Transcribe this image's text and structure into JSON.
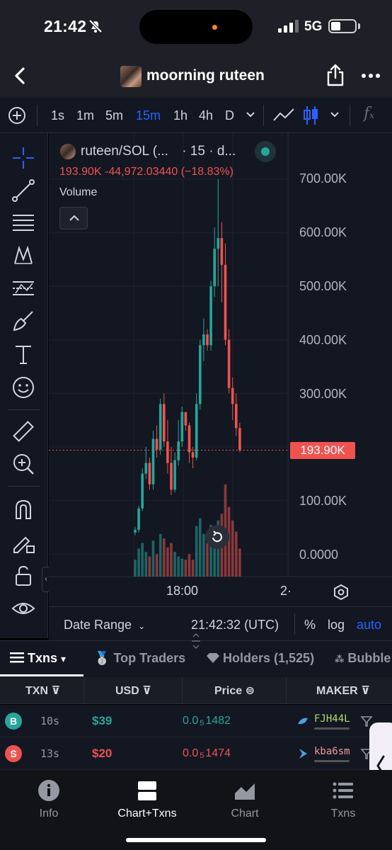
{
  "status_bar": {
    "time": "21:42",
    "network": "5G"
  },
  "header": {
    "title": "moorning ruteen"
  },
  "toolbar": {
    "intervals": [
      "1s",
      "1m",
      "5m",
      "15m",
      "1h",
      "4h",
      "D"
    ],
    "active_interval": "15m",
    "colors": {
      "active": "#2962ff"
    }
  },
  "legend": {
    "symbol": "ruteen/SOL (...",
    "interval": "· 15 · d...",
    "ohlc": "193.90K  -44,972.03440 (−18.83%)",
    "volume_label": "Volume"
  },
  "chart_data": {
    "type": "candlestick",
    "price_axis_labels": [
      "700.00K",
      "600.00K",
      "500.00K",
      "400.00K",
      "300.00K",
      "100.00K",
      "0.0000"
    ],
    "time_axis_labels": [
      "18:00",
      "2·"
    ],
    "last_price_label": "193.90K",
    "ylim": [
      0,
      720000
    ],
    "up_color": "#26a69a",
    "down_color": "#ef5350",
    "candles": [
      [
        40000,
        50000,
        35000,
        45000,
        150
      ],
      [
        45000,
        90000,
        40000,
        85000,
        250
      ],
      [
        85000,
        160000,
        80000,
        150000,
        300
      ],
      [
        150000,
        200000,
        140000,
        170000,
        220
      ],
      [
        170000,
        180000,
        120000,
        130000,
        180
      ],
      [
        130000,
        230000,
        120000,
        215000,
        320
      ],
      [
        215000,
        240000,
        180000,
        195000,
        200
      ],
      [
        195000,
        290000,
        185000,
        280000,
        380
      ],
      [
        280000,
        300000,
        200000,
        210000,
        340
      ],
      [
        210000,
        250000,
        150000,
        170000,
        260
      ],
      [
        170000,
        200000,
        110000,
        120000,
        300
      ],
      [
        120000,
        190000,
        115000,
        175000,
        220
      ],
      [
        175000,
        250000,
        165000,
        210000,
        180
      ],
      [
        210000,
        275000,
        200000,
        265000,
        160
      ],
      [
        265000,
        250000,
        230000,
        240000,
        150
      ],
      [
        240000,
        245000,
        170000,
        190000,
        200
      ],
      [
        190000,
        200000,
        160000,
        180000,
        150
      ],
      [
        180000,
        300000,
        175000,
        280000,
        450
      ],
      [
        280000,
        400000,
        270000,
        390000,
        520
      ],
      [
        390000,
        440000,
        360000,
        410000,
        380
      ],
      [
        410000,
        420000,
        380000,
        390000,
        300
      ],
      [
        390000,
        510000,
        380000,
        500000,
        460
      ],
      [
        500000,
        610000,
        480000,
        570000,
        420
      ],
      [
        570000,
        700000,
        500000,
        590000,
        500
      ],
      [
        590000,
        620000,
        470000,
        540000,
        560
      ],
      [
        540000,
        580000,
        390000,
        400000,
        820
      ],
      [
        400000,
        420000,
        300000,
        310000,
        620
      ],
      [
        310000,
        330000,
        250000,
        280000,
        500
      ],
      [
        280000,
        300000,
        220000,
        235000,
        400
      ],
      [
        235000,
        245000,
        190000,
        193900,
        250
      ]
    ]
  },
  "range_bar": {
    "date_range": "Date Range",
    "clock": "21:42:32 (UTC)",
    "percent": "%",
    "log": "log",
    "auto": "auto"
  },
  "tabs": [
    {
      "label": "Txns"
    },
    {
      "label": "Top Traders"
    },
    {
      "label": "Holders (1,525)"
    },
    {
      "label": "Bubble"
    }
  ],
  "table": {
    "headers": [
      "TXN",
      "USD",
      "Price",
      "MAKER"
    ],
    "rows": [
      {
        "type": "B",
        "age": "10s",
        "usd": "$39",
        "price_lead": "0.0",
        "price_sub": "5",
        "price_tail": "1482",
        "maker": "FJH44L",
        "color": "#26a69a"
      },
      {
        "type": "S",
        "age": "13s",
        "usd": "$20",
        "price_lead": "0.0",
        "price_sub": "5",
        "price_tail": "1474",
        "maker": "kba6sm",
        "color": "#ef5350"
      }
    ]
  },
  "bottom_nav": [
    {
      "label": "Info"
    },
    {
      "label": "Chart+Txns"
    },
    {
      "label": "Chart"
    },
    {
      "label": "Txns"
    }
  ]
}
